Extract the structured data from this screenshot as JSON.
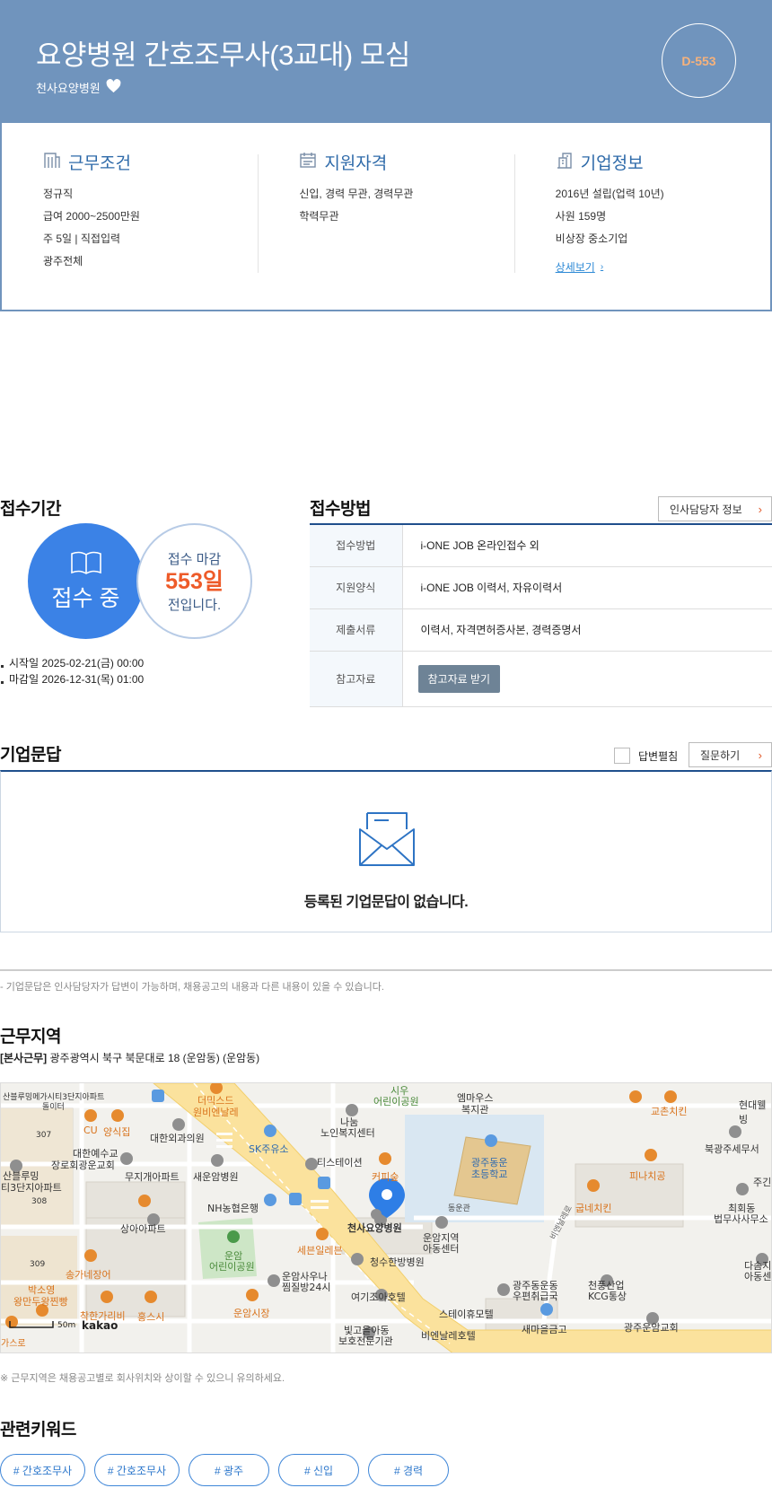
{
  "header": {
    "title": "요양병원 간호조무사(3교대) 모심",
    "company": "천사요양병원",
    "dday": "D-553"
  },
  "conditions": {
    "work": {
      "title": "근무조건",
      "lines": [
        "정규직",
        "급여 2000~2500만원",
        "주 5일 | 직접입력",
        "광주전체"
      ]
    },
    "qualification": {
      "title": "지원자격",
      "lines": [
        "신입, 경력 무관, 경력무관",
        "학력무관"
      ]
    },
    "company": {
      "title": "기업정보",
      "lines": [
        "2016년 설립(업력 10년)",
        "사원 159명",
        "비상장 중소기업"
      ],
      "link": "상세보기"
    }
  },
  "period": {
    "title": "접수기간",
    "status": "접수 중",
    "deadline_top": "접수 마감",
    "deadline_days": "553일",
    "deadline_bottom": "전입니다.",
    "start": "시작일 2025-02-21(금) 00:00",
    "end": "마감일 2026-12-31(목) 01:00"
  },
  "method": {
    "title": "접수방법",
    "manager_button": "인사담당자 정보",
    "rows": [
      {
        "label": "접수방법",
        "value": "i-ONE JOB 온라인접수 외"
      },
      {
        "label": "지원양식",
        "value": "i-ONE JOB 이력서, 자유이력서"
      },
      {
        "label": "제출서류",
        "value": "이력서, 자격면허증사본, 경력증명서"
      },
      {
        "label": "참고자료",
        "button": "참고자료 받기"
      }
    ]
  },
  "qna": {
    "title": "기업문답",
    "filter_label": "답변펼침",
    "ask_button": "질문하기",
    "empty_text": "등록된 기업문답이 없습니다.",
    "note": "- 기업문답은 인사담당자가 답변이 가능하며, 채용공고의 내용과 다른 내용이 있을 수 있습니다."
  },
  "location": {
    "title": "근무지역",
    "tag": "[본사근무]",
    "address": "광주광역시 북구 북문대로 18 (운암동) (운암동)",
    "note": "※ 근무지역은 채용공고별로 회사위치와 상이할 수 있으니 유의하세요.",
    "map": {
      "scale": "50m",
      "brand": "kakao",
      "pin_label": "천사요양병원",
      "labels": {
        "l1": "산블루밍메가시티3단지아파트",
        "l1b": "돌이터",
        "l2": "CU",
        "l3": "양식집",
        "l4": "더믹스드",
        "l4b": "원비엔날레",
        "l5": "시우",
        "l5b": "어린이공원",
        "l6": "엠마우스",
        "l6b": "복지관",
        "l7": "교촌치킨",
        "l8": "현대웰빙",
        "l9": "대한외과의원",
        "l10": "나눔",
        "l10b": "노인복지센터",
        "l11": "307",
        "l12": "대한예수교",
        "l12b": "장로회광운교회",
        "l13": "SK주유소",
        "l14": "티스테이션",
        "l15": "커피숲",
        "l16": "광주동운",
        "l16b": "초등학교",
        "l17": "북광주세무서",
        "l18": "피나치공",
        "l19": "산블루밍",
        "l19b": "티3단지아파트",
        "l20": "무지개아파트",
        "l21": "새운암병원",
        "l22": "308",
        "l23": "NH농협은행",
        "l24": "동운관",
        "l25": "굽네치킨",
        "l26": "최회동",
        "l26b": "법무사사무소",
        "l27": "상아아파트",
        "l28": "운암",
        "l28b": "어린이공원",
        "l29": "세븐일레븐",
        "l30": "운암지역",
        "l30b": "아동센터",
        "l31": "비엔날레로",
        "l32": "309",
        "l33": "송가네장어",
        "l34": "청수한방병원",
        "l35": "운암사우나",
        "l35b": "찜질방24시",
        "l36": "광주동운동",
        "l36b": "우편취급국",
        "l37": "천풍산업",
        "l37b": "KCG통상",
        "l38": "다솜지",
        "l38b": "아동센",
        "l39": "박소영",
        "l39b": "왕만두왕찐빵",
        "l40": "여기조아호텔",
        "l41": "스테이휴모텔",
        "l42": "착한가리비",
        "l43": "홍스시",
        "l44": "운암시장",
        "l45": "빛고을아동",
        "l45b": "보호전문기관",
        "l46": "비엔날레호텔",
        "l47": "새마을금고",
        "l48": "광주운암교회",
        "l49": "가스로",
        "l50": "주긴"
      }
    }
  },
  "keywords": {
    "title": "관련키워드",
    "items": [
      "# 간호조무사",
      "# 간호조무사",
      "# 광주",
      "# 신입",
      "# 경력"
    ]
  },
  "colors": {
    "header_bg": "#7094bd",
    "accent_blue": "#2e6aa9",
    "status_blue": "#3b82e6",
    "deadline_orange": "#ee5b29"
  }
}
